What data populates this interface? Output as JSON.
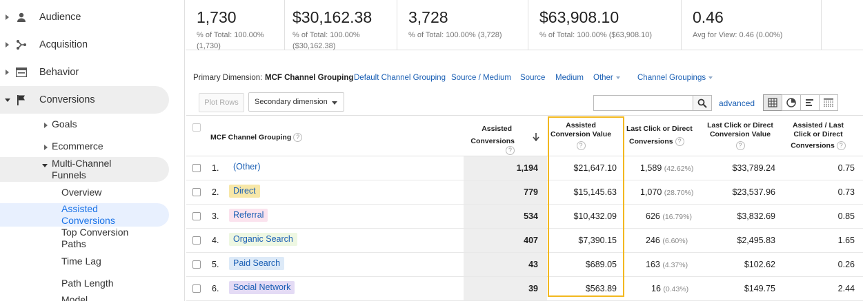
{
  "sidebar": {
    "top_items": [
      {
        "label": "Audience",
        "icon": "person-icon"
      },
      {
        "label": "Acquisition",
        "icon": "acquisition-icon"
      },
      {
        "label": "Behavior",
        "icon": "behavior-icon"
      },
      {
        "label": "Conversions",
        "icon": "flag-icon"
      }
    ],
    "sub_items": [
      {
        "label": "Goals"
      },
      {
        "label": "Ecommerce"
      },
      {
        "label": "Multi-Channel Funnels"
      }
    ],
    "leaves": [
      {
        "label": "Overview"
      },
      {
        "label": "Assisted Conversions"
      },
      {
        "label": "Top Conversion Paths"
      },
      {
        "label": "Time Lag"
      },
      {
        "label": "Path Length"
      },
      {
        "label": "Model"
      }
    ]
  },
  "metrics": [
    {
      "value": "1,730",
      "sub1": "% of Total: 100.00%",
      "sub2": "(1,730)"
    },
    {
      "value": "$30,162.38",
      "sub1": "% of Total: 100.00%",
      "sub2": "($30,162.38)"
    },
    {
      "value": "3,728",
      "sub1": "% of Total: 100.00% (3,728)",
      "sub2": ""
    },
    {
      "value": "$63,908.10",
      "sub1": "% of Total: 100.00% ($63,908.10)",
      "sub2": ""
    },
    {
      "value": "0.46",
      "sub1": "Avg for View: 0.46 (0.00%)",
      "sub2": ""
    }
  ],
  "dimension_bar": {
    "primary_label": "Primary Dimension:",
    "current": "MCF Channel Grouping",
    "options": [
      "Default Channel Grouping",
      "Source / Medium",
      "Source",
      "Medium"
    ],
    "other": "Other",
    "channel_groupings": "Channel Groupings"
  },
  "toolbar": {
    "plot_rows": "Plot Rows",
    "secondary_dimension": "Secondary dimension",
    "search_value": "",
    "advanced": "advanced"
  },
  "table": {
    "headers": {
      "dimension": "MCF Channel Grouping",
      "assisted_conversions_1": "Assisted",
      "assisted_conversions_2": "Conversions",
      "assisted_value_1": "Assisted",
      "assisted_value_2": "Conversion Value",
      "last_click_1": "Last Click or Direct",
      "last_click_2": "Conversions",
      "last_click_value_1": "Last Click or Direct",
      "last_click_value_2": "Conversion Value",
      "ratio_1": "Assisted / Last",
      "ratio_2": "Click or Direct",
      "ratio_3": "Conversions",
      "help": "?"
    },
    "rows": [
      {
        "index": "1.",
        "channel": "(Other)",
        "tag_color": "",
        "assisted": "1,194",
        "assisted_value": "$21,647.10",
        "last_click": "1,589",
        "last_click_pct": "(42.62%)",
        "last_click_value": "$33,789.24",
        "ratio": "0.75"
      },
      {
        "index": "2.",
        "channel": "Direct",
        "tag_color": "#f7e7a8",
        "assisted": "779",
        "assisted_value": "$15,145.63",
        "last_click": "1,070",
        "last_click_pct": "(28.70%)",
        "last_click_value": "$23,537.96",
        "ratio": "0.73"
      },
      {
        "index": "3.",
        "channel": "Referral",
        "tag_color": "#fbe3ee",
        "assisted": "534",
        "assisted_value": "$10,432.09",
        "last_click": "626",
        "last_click_pct": "(16.79%)",
        "last_click_value": "$3,832.69",
        "ratio": "0.85"
      },
      {
        "index": "4.",
        "channel": "Organic Search",
        "tag_color": "#eef7e2",
        "assisted": "407",
        "assisted_value": "$7,390.15",
        "last_click": "246",
        "last_click_pct": "(6.60%)",
        "last_click_value": "$2,495.83",
        "ratio": "1.65"
      },
      {
        "index": "5.",
        "channel": "Paid Search",
        "tag_color": "#ddeaf8",
        "assisted": "43",
        "assisted_value": "$689.05",
        "last_click": "163",
        "last_click_pct": "(4.37%)",
        "last_click_value": "$102.62",
        "ratio": "0.26"
      },
      {
        "index": "6.",
        "channel": "Social Network",
        "tag_color": "#e4dbf5",
        "assisted": "39",
        "assisted_value": "$563.89",
        "last_click": "16",
        "last_click_pct": "(0.43%)",
        "last_click_value": "$149.75",
        "ratio": "2.44"
      }
    ]
  },
  "colors": {
    "link": "#1a5fb4",
    "highlight_border": "#f2b81f",
    "active_nav_bg": "#eeeeee",
    "selected_leaf_bg": "#e8f0fe",
    "selected_leaf_text": "#1a73e8"
  }
}
